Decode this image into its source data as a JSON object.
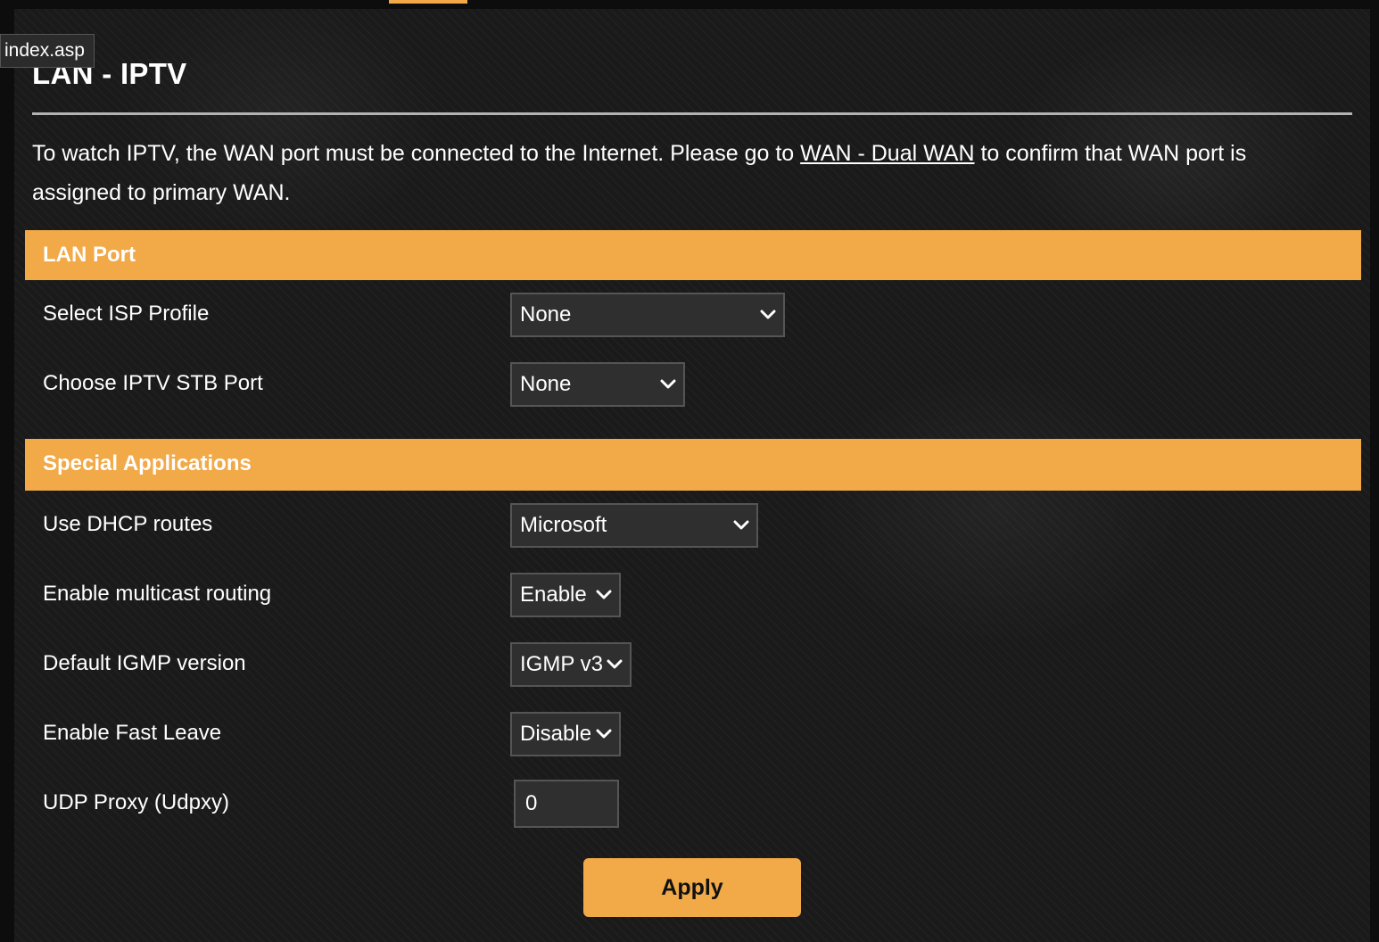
{
  "tooltip": "index.asp",
  "page_title": "LAN - IPTV",
  "intro": {
    "text_before": "To watch IPTV, the WAN port must be connected to the Internet. Please go to ",
    "link": "WAN - Dual WAN",
    "text_after": " to confirm that WAN port is assigned to primary WAN."
  },
  "sections": {
    "lan_port": {
      "title": "LAN Port",
      "isp_profile": {
        "label": "Select ISP Profile",
        "value": "None"
      },
      "stb_port": {
        "label": "Choose IPTV STB Port",
        "value": "None"
      }
    },
    "special_apps": {
      "title": "Special Applications",
      "dhcp_routes": {
        "label": "Use DHCP routes",
        "value": "Microsoft"
      },
      "multicast_routing": {
        "label": "Enable multicast routing",
        "value": "Enable"
      },
      "igmp_version": {
        "label": "Default IGMP version",
        "value": "IGMP v3"
      },
      "fast_leave": {
        "label": "Enable Fast Leave",
        "value": "Disable"
      },
      "udp_proxy": {
        "label": "UDP Proxy (Udpxy)",
        "value": "0"
      }
    }
  },
  "apply_label": "Apply",
  "colors": {
    "accent": "#f2a947",
    "panel_bg": "#1a1a1a",
    "control_bg": "#2f2f2f"
  }
}
